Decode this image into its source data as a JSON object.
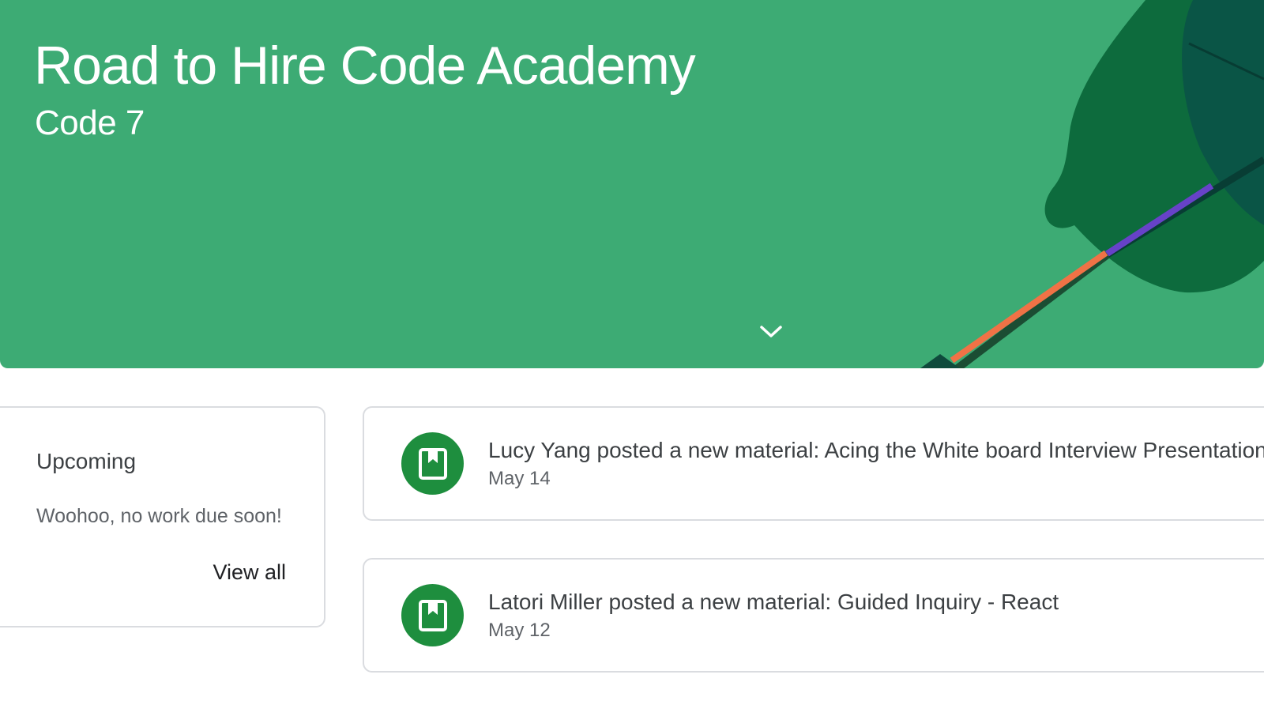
{
  "banner": {
    "title": "Road to Hire Code Academy",
    "subtitle": "Code 7",
    "background_color": "#3dab74",
    "expand_icon": "chevron-down-icon"
  },
  "upcoming": {
    "title": "Upcoming",
    "empty_message": "Woohoo, no work due soon!",
    "view_all_label": "View all"
  },
  "stream": {
    "posts": [
      {
        "text": "Lucy Yang posted a new material: Acing the White board Interview Presentation",
        "date": "May 14",
        "icon": "material-book-icon"
      },
      {
        "text": "Latori Miller posted a new material: Guided Inquiry - React",
        "date": "May 12",
        "icon": "material-book-icon"
      }
    ]
  },
  "colors": {
    "accent": "#1e8e3e",
    "card_border": "#dadce0"
  }
}
